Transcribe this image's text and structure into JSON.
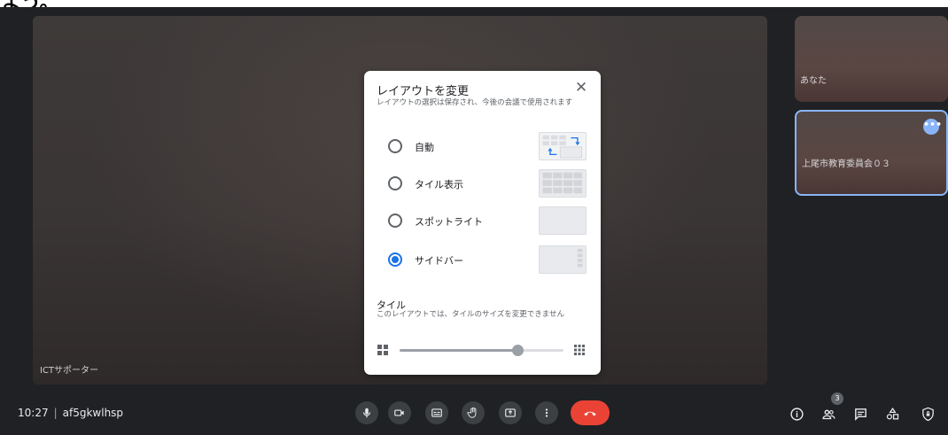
{
  "header_fragment": "よう。",
  "main_tile": {
    "name": "ICTサポーター"
  },
  "side_tiles": [
    {
      "name": "あなた"
    },
    {
      "name": "上尾市教育委員会０３",
      "more_icon": "more-horizontal-icon"
    }
  ],
  "bottom_bar": {
    "time": "10:27",
    "separator": "|",
    "meeting_code": "af5gkwlhsp",
    "controls": [
      "mic-icon",
      "camera-icon",
      "captions-icon",
      "raise-hand-icon",
      "present-icon",
      "more-vert-icon",
      "end-call-icon"
    ],
    "right_icons": [
      "info-icon",
      "people-icon",
      "chat-icon",
      "activities-icon",
      "lock-icon"
    ],
    "participant_count": "3"
  },
  "dialog": {
    "title": "レイアウトを変更",
    "description": "レイアウトの選択は保存され、今後の会議で使用されます",
    "options": [
      {
        "label": "自動",
        "selected": false
      },
      {
        "label": "タイル表示",
        "selected": false
      },
      {
        "label": "スポットライト",
        "selected": false
      },
      {
        "label": "サイドバー",
        "selected": true
      }
    ],
    "tile_section": {
      "title": "タイル",
      "description": "このレイアウトでは、タイルのサイズを変更できません",
      "slider_value": 0.72
    }
  },
  "colors": {
    "accent": "#1a73e8",
    "end_call": "#ea4335",
    "background": "#202124",
    "highlight_border": "#8ab4f8"
  }
}
